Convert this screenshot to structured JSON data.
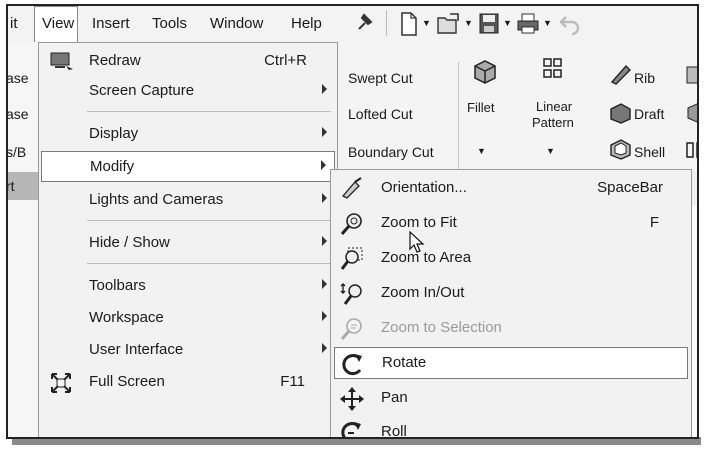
{
  "menubar": {
    "items": [
      "it",
      "View",
      "Insert",
      "Tools",
      "Window",
      "Help"
    ]
  },
  "left_strip": [
    "ase",
    "ase",
    "s/B",
    "rt"
  ],
  "ribbon": {
    "swept_cut": "Swept Cut",
    "lofted_cut": "Lofted Cut",
    "boundary_cut": "Boundary Cut",
    "fillet": "Fillet",
    "linear_pattern_1": "Linear",
    "linear_pattern_2": "Pattern",
    "rib": "Rib",
    "draft": "Draft",
    "shell": "Shell"
  },
  "view_menu": {
    "redraw": {
      "label": "Redraw",
      "shortcut": "Ctrl+R"
    },
    "screen_capture": "Screen Capture",
    "display": "Display",
    "modify": "Modify",
    "lights_cameras": "Lights and Cameras",
    "hide_show": "Hide / Show",
    "toolbars": "Toolbars",
    "workspace": "Workspace",
    "user_interface": "User Interface",
    "full_screen": {
      "label": "Full Screen",
      "shortcut": "F11"
    }
  },
  "modify_submenu": {
    "orientation": {
      "label": "Orientation...",
      "shortcut": "SpaceBar"
    },
    "zoom_fit": {
      "label": "Zoom to Fit",
      "shortcut": "F"
    },
    "zoom_area": "Zoom to Area",
    "zoom_inout": "Zoom In/Out",
    "zoom_selection": "Zoom to Selection",
    "rotate": "Rotate",
    "pan": "Pan",
    "roll": "Roll"
  }
}
